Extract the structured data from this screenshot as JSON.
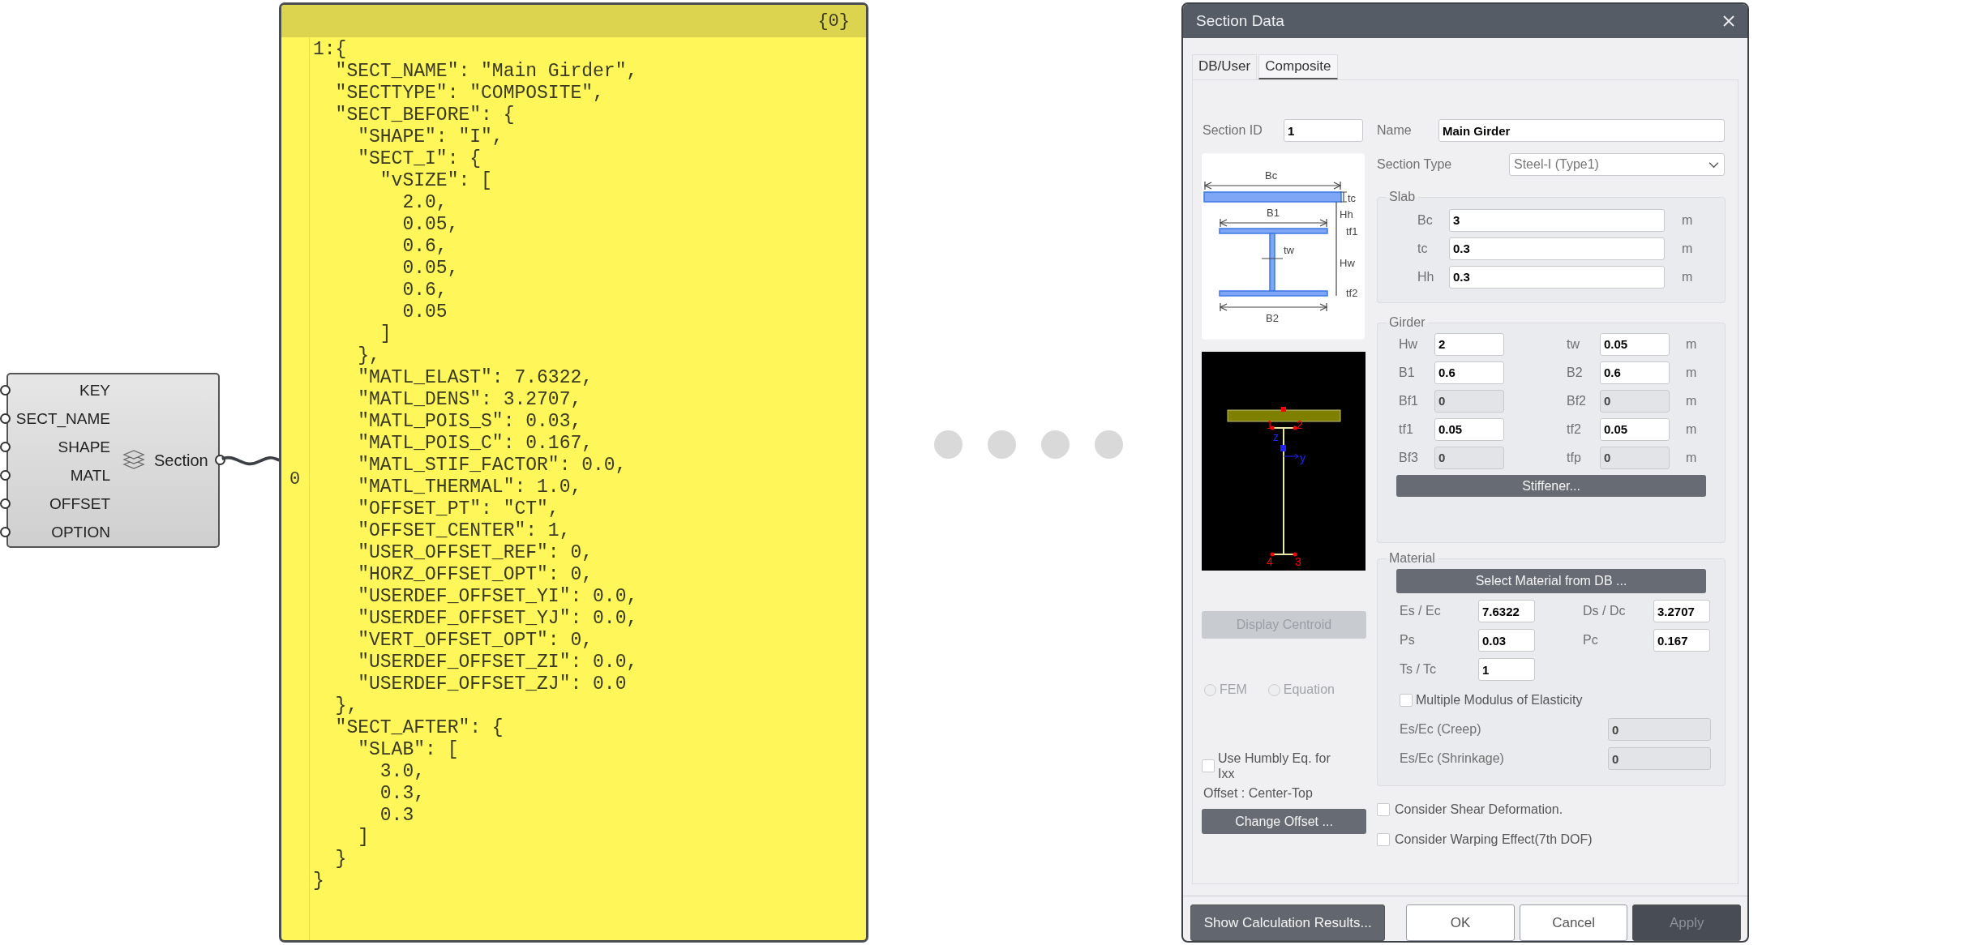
{
  "canvas": {
    "component": {
      "inputs": [
        "KEY",
        "SECT_NAME",
        "SHAPE",
        "MATL",
        "OFFSET",
        "OPTION"
      ],
      "label": "Section"
    },
    "panel": {
      "path": "{0}",
      "index": "0",
      "lines": [
        "1:{",
        "  \"SECT_NAME\": \"Main Girder\",",
        "  \"SECTTYPE\": \"COMPOSITE\",",
        "  \"SECT_BEFORE\": {",
        "    \"SHAPE\": \"I\",",
        "    \"SECT_I\": {",
        "      \"vSIZE\": [",
        "        2.0,",
        "        0.05,",
        "        0.6,",
        "        0.05,",
        "        0.6,",
        "        0.05",
        "      ]",
        "    },",
        "    \"MATL_ELAST\": 7.6322,",
        "    \"MATL_DENS\": 3.2707,",
        "    \"MATL_POIS_S\": 0.03,",
        "    \"MATL_POIS_C\": 0.167,",
        "    \"MATL_STIF_FACTOR\": 0.0,",
        "    \"MATL_THERMAL\": 1.0,",
        "    \"OFFSET_PT\": \"CT\",",
        "    \"OFFSET_CENTER\": 1,",
        "    \"USER_OFFSET_REF\": 0,",
        "    \"HORZ_OFFSET_OPT\": 0,",
        "    \"USERDEF_OFFSET_YI\": 0.0,",
        "    \"USERDEF_OFFSET_YJ\": 0.0,",
        "    \"VERT_OFFSET_OPT\": 0,",
        "    \"USERDEF_OFFSET_ZI\": 0.0,",
        "    \"USERDEF_OFFSET_ZJ\": 0.0",
        "  },",
        "  \"SECT_AFTER\": {",
        "    \"SLAB\": [",
        "      3.0,",
        "      0.3,",
        "      0.3",
        "    ]",
        "  }",
        "}"
      ]
    }
  },
  "dialog": {
    "title": "Section Data",
    "tabs": [
      {
        "label": "DB/User",
        "selected": false
      },
      {
        "label": "Composite",
        "selected": true
      }
    ],
    "section_id": {
      "label": "Section ID",
      "value": "1"
    },
    "name": {
      "label": "Name",
      "value": "Main Girder"
    },
    "section_type": {
      "label": "Section Type",
      "value": "Steel-I (Type1)"
    },
    "diagram_labels": {
      "bc": "Bc",
      "tc": "tc",
      "b1": "B1",
      "hh": "Hh",
      "tf1": "tf1",
      "tw": "tw",
      "hw": "Hw",
      "tf2": "tf2",
      "b2": "B2"
    },
    "preview_labels": {
      "p1": "1",
      "p2": "2",
      "z": "z",
      "y": "y",
      "p4": "4",
      "p3": "3"
    },
    "slab": {
      "title": "Slab",
      "rows": [
        {
          "label": "Bc",
          "value": "3",
          "unit": "m"
        },
        {
          "label": "tc",
          "value": "0.3",
          "unit": "m"
        },
        {
          "label": "Hh",
          "value": "0.3",
          "unit": "m"
        }
      ]
    },
    "girder": {
      "title": "Girder",
      "rows": [
        {
          "left": {
            "label": "Hw",
            "value": "2",
            "disabled": false
          },
          "right": {
            "label": "tw",
            "value": "0.05",
            "disabled": false
          },
          "unit": "m"
        },
        {
          "left": {
            "label": "B1",
            "value": "0.6",
            "disabled": false
          },
          "right": {
            "label": "B2",
            "value": "0.6",
            "disabled": false
          },
          "unit": "m"
        },
        {
          "left": {
            "label": "Bf1",
            "value": "0",
            "disabled": true
          },
          "right": {
            "label": "Bf2",
            "value": "0",
            "disabled": true
          },
          "unit": "m"
        },
        {
          "left": {
            "label": "tf1",
            "value": "0.05",
            "disabled": false
          },
          "right": {
            "label": "tf2",
            "value": "0.05",
            "disabled": false
          },
          "unit": "m"
        },
        {
          "left": {
            "label": "Bf3",
            "value": "0",
            "disabled": true
          },
          "right": {
            "label": "tfp",
            "value": "0",
            "disabled": true
          },
          "unit": "m"
        }
      ],
      "stiffener_button": "Stiffener..."
    },
    "material": {
      "title": "Material",
      "select_button": "Select Material from DB ...",
      "rows": [
        {
          "left": {
            "label": "Es / Ec",
            "value": "7.6322"
          },
          "right": {
            "label": "Ds / Dc",
            "value": "3.2707"
          }
        },
        {
          "left": {
            "label": "Ps",
            "value": "0.03"
          },
          "right": {
            "label": "Pc",
            "value": "0.167"
          }
        },
        {
          "left": {
            "label": "Ts / Tc",
            "value": "1"
          }
        }
      ],
      "multiple_modulus": {
        "label": "Multiple Modulus of Elasticity",
        "checked": false
      },
      "ratios": [
        {
          "label": "Es/Ec (Creep)",
          "value": "0"
        },
        {
          "label": "Es/Ec (Shrinkage)",
          "value": "0"
        }
      ]
    },
    "display_centroid": {
      "label": "Display Centroid",
      "disabled": true
    },
    "methods": [
      {
        "label": "FEM",
        "selected": false,
        "disabled": true
      },
      {
        "label": "Equation",
        "selected": false,
        "disabled": true
      }
    ],
    "humbly": {
      "label": "Use Humbly Eq. for Ixx",
      "checked": false
    },
    "offset_text": "Offset : Center-Top",
    "change_offset_button": "Change Offset ...",
    "options": [
      {
        "label": "Consider Shear Deformation.",
        "checked": false
      },
      {
        "label": "Consider Warping Effect(7th DOF)",
        "checked": false
      }
    ],
    "footer_buttons": [
      {
        "label": "Show Calculation Results...",
        "kind": "dark",
        "disabled": false
      },
      {
        "label": "OK",
        "kind": "light",
        "disabled": false
      },
      {
        "label": "Cancel",
        "kind": "light",
        "disabled": false
      },
      {
        "label": "Apply",
        "kind": "dark",
        "disabled": true
      }
    ]
  }
}
